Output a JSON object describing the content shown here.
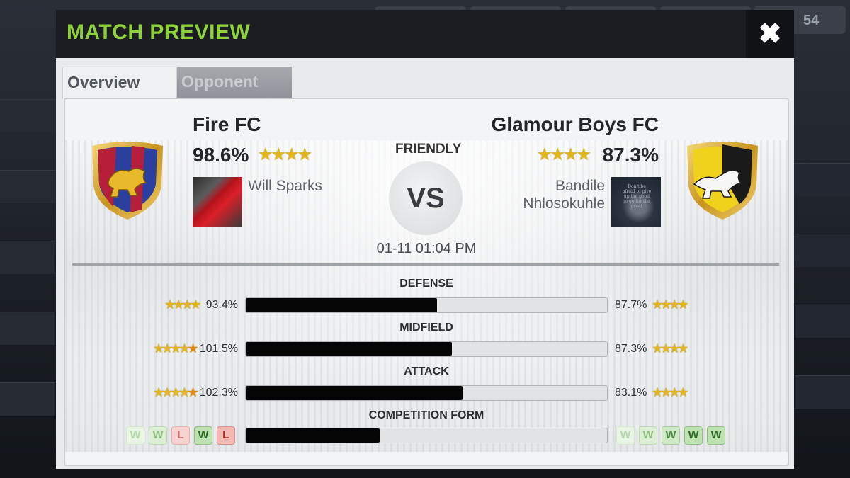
{
  "modal": {
    "title": "MATCH PREVIEW",
    "close_label": "✖",
    "tabs": [
      {
        "label": "Overview",
        "active": true
      },
      {
        "label": "Opponent",
        "active": false
      }
    ]
  },
  "background": {
    "counter": "54"
  },
  "match": {
    "type": "FRIENDLY",
    "vs": "VS",
    "datetime": "01-11 01:04 PM"
  },
  "home": {
    "name": "Fire FC",
    "rating": "98.6%",
    "stars": "★★★★",
    "manager": "Will Sparks",
    "crest_colors": [
      "#b51f3a",
      "#2b3f9e",
      "#d4a62a"
    ]
  },
  "away": {
    "name": "Glamour Boys FC",
    "rating": "87.3%",
    "stars": "★★★★",
    "manager_line1": "Bandile",
    "manager_line2": "Nhlosokuhle",
    "avatar_text": "Don't be afraid to give up the good to go for the great",
    "crest_colors": [
      "#1a1a1a",
      "#f0d21c",
      "#d4a62a"
    ]
  },
  "stats": [
    {
      "title": "DEFENSE",
      "home_value": "93.4%",
      "away_value": "87.7%",
      "home_share": 0.53,
      "home_stars": "★★★★",
      "home_half": "",
      "away_stars": "★★★★"
    },
    {
      "title": "MIDFIELD",
      "home_value": "101.5%",
      "away_value": "87.3%",
      "home_share": 0.57,
      "home_stars": "★★★★",
      "home_half": "★",
      "away_stars": "★★★★"
    },
    {
      "title": "ATTACK",
      "home_value": "102.3%",
      "away_value": "83.1%",
      "home_share": 0.6,
      "home_stars": "★★★★",
      "home_half": "★",
      "away_stars": "★★★★"
    }
  ],
  "form": {
    "title": "COMPETITION FORM",
    "home_share": 0.37,
    "home_results": [
      "W",
      "W",
      "L",
      "W",
      "L"
    ],
    "away_results": [
      "W",
      "W",
      "W",
      "W",
      "W"
    ]
  }
}
